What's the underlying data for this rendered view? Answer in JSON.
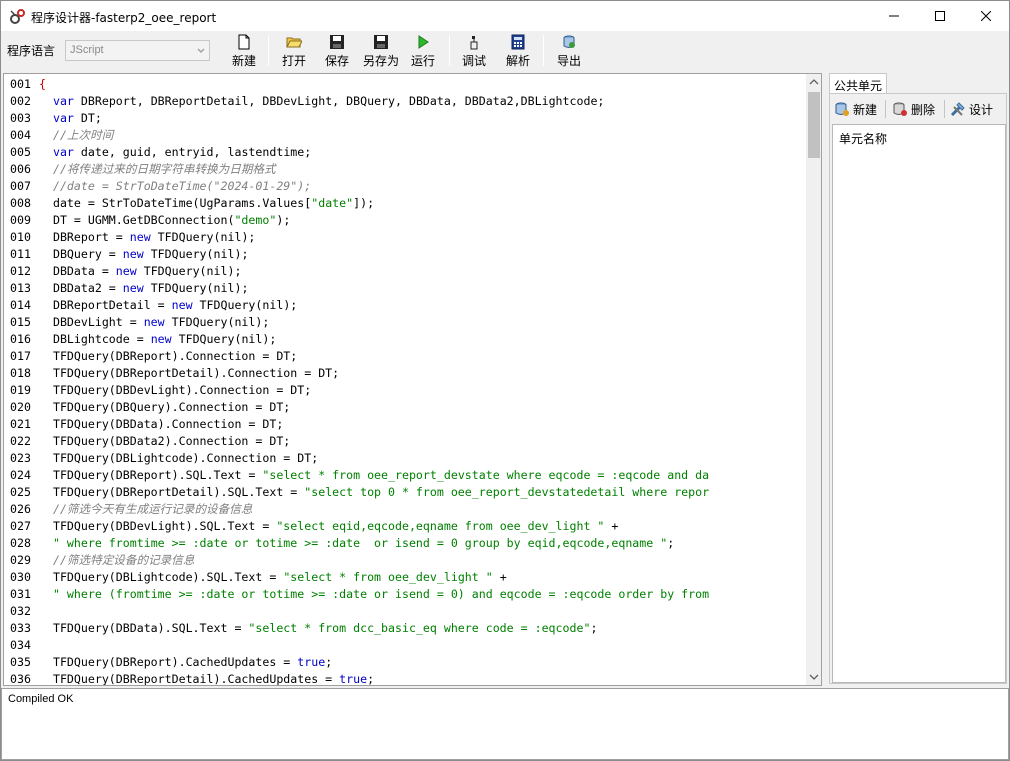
{
  "window": {
    "title": "程序设计器-fasterp2_oee_report"
  },
  "toolbar": {
    "lang_label": "程序语言",
    "lang_value": "JScript",
    "buttons": [
      {
        "label": "新建",
        "icon": "new-file-icon"
      },
      {
        "label": "打开",
        "icon": "open-folder-icon"
      },
      {
        "label": "保存",
        "icon": "save-icon"
      },
      {
        "label": "另存为",
        "icon": "save-as-icon"
      },
      {
        "label": "运行",
        "icon": "run-icon"
      },
      {
        "label": "调试",
        "icon": "debug-icon"
      },
      {
        "label": "解析",
        "icon": "parse-icon"
      },
      {
        "label": "导出",
        "icon": "export-icon"
      }
    ]
  },
  "editor": {
    "lines": [
      {
        "n": "001",
        "t": [
          [
            "sym",
            "{"
          ]
        ]
      },
      {
        "n": "002",
        "t": [
          [
            "id",
            "  "
          ],
          [
            "kw",
            "var"
          ],
          [
            "id",
            " DBReport, DBReportDetail, DBDevLight, DBQuery, DBData, DBData2,DBLightcode;"
          ]
        ]
      },
      {
        "n": "003",
        "t": [
          [
            "id",
            "  "
          ],
          [
            "kw",
            "var"
          ],
          [
            "id",
            " DT;"
          ]
        ]
      },
      {
        "n": "004",
        "t": [
          [
            "id",
            "  "
          ],
          [
            "cmt",
            "//上次时间"
          ]
        ]
      },
      {
        "n": "005",
        "t": [
          [
            "id",
            "  "
          ],
          [
            "kw",
            "var"
          ],
          [
            "id",
            " date, guid, entryid, lastendtime;"
          ]
        ]
      },
      {
        "n": "006",
        "t": [
          [
            "id",
            "  "
          ],
          [
            "cmt",
            "//将传递过来的日期字符串转换为日期格式"
          ]
        ]
      },
      {
        "n": "007",
        "t": [
          [
            "id",
            "  "
          ],
          [
            "cmt",
            "//date = StrToDateTime(\"2024-01-29\");"
          ]
        ]
      },
      {
        "n": "008",
        "t": [
          [
            "id",
            "  date = StrToDateTime(UgParams.Values["
          ],
          [
            "str",
            "\"date\""
          ],
          [
            "id",
            "]);"
          ]
        ]
      },
      {
        "n": "009",
        "t": [
          [
            "id",
            "  DT = UGMM.GetDBConnection("
          ],
          [
            "str",
            "\"demo\""
          ],
          [
            "id",
            ");"
          ]
        ]
      },
      {
        "n": "010",
        "t": [
          [
            "id",
            "  DBReport = "
          ],
          [
            "kw",
            "new"
          ],
          [
            "id",
            " TFDQuery(nil);"
          ]
        ]
      },
      {
        "n": "011",
        "t": [
          [
            "id",
            "  DBQuery = "
          ],
          [
            "kw",
            "new"
          ],
          [
            "id",
            " TFDQuery(nil);"
          ]
        ]
      },
      {
        "n": "012",
        "t": [
          [
            "id",
            "  DBData = "
          ],
          [
            "kw",
            "new"
          ],
          [
            "id",
            " TFDQuery(nil);"
          ]
        ]
      },
      {
        "n": "013",
        "t": [
          [
            "id",
            "  DBData2 = "
          ],
          [
            "kw",
            "new"
          ],
          [
            "id",
            " TFDQuery(nil);"
          ]
        ]
      },
      {
        "n": "014",
        "t": [
          [
            "id",
            "  DBReportDetail = "
          ],
          [
            "kw",
            "new"
          ],
          [
            "id",
            " TFDQuery(nil);"
          ]
        ]
      },
      {
        "n": "015",
        "t": [
          [
            "id",
            "  DBDevLight = "
          ],
          [
            "kw",
            "new"
          ],
          [
            "id",
            " TFDQuery(nil);"
          ]
        ]
      },
      {
        "n": "016",
        "t": [
          [
            "id",
            "  DBLightcode = "
          ],
          [
            "kw",
            "new"
          ],
          [
            "id",
            " TFDQuery(nil);"
          ]
        ]
      },
      {
        "n": "017",
        "t": [
          [
            "id",
            "  TFDQuery(DBReport).Connection = DT;"
          ]
        ]
      },
      {
        "n": "018",
        "t": [
          [
            "id",
            "  TFDQuery(DBReportDetail).Connection = DT;"
          ]
        ]
      },
      {
        "n": "019",
        "t": [
          [
            "id",
            "  TFDQuery(DBDevLight).Connection = DT;"
          ]
        ]
      },
      {
        "n": "020",
        "t": [
          [
            "id",
            "  TFDQuery(DBQuery).Connection = DT;"
          ]
        ]
      },
      {
        "n": "021",
        "t": [
          [
            "id",
            "  TFDQuery(DBData).Connection = DT;"
          ]
        ]
      },
      {
        "n": "022",
        "t": [
          [
            "id",
            "  TFDQuery(DBData2).Connection = DT;"
          ]
        ]
      },
      {
        "n": "023",
        "t": [
          [
            "id",
            "  TFDQuery(DBLightcode).Connection = DT;"
          ]
        ]
      },
      {
        "n": "024",
        "t": [
          [
            "id",
            "  TFDQuery(DBReport).SQL.Text = "
          ],
          [
            "str",
            "\"select * from oee_report_devstate where eqcode = :eqcode and da"
          ]
        ]
      },
      {
        "n": "025",
        "t": [
          [
            "id",
            "  TFDQuery(DBReportDetail).SQL.Text = "
          ],
          [
            "str",
            "\"select top 0 * from oee_report_devstatedetail where repor"
          ]
        ]
      },
      {
        "n": "026",
        "t": [
          [
            "id",
            "  "
          ],
          [
            "cmt",
            "//筛选今天有生成运行记录的设备信息"
          ]
        ]
      },
      {
        "n": "027",
        "t": [
          [
            "id",
            "  TFDQuery(DBDevLight).SQL.Text = "
          ],
          [
            "str",
            "\"select eqid,eqcode,eqname from oee_dev_light \""
          ],
          [
            "id",
            " +"
          ]
        ]
      },
      {
        "n": "028",
        "t": [
          [
            "id",
            "  "
          ],
          [
            "str",
            "\" where fromtime >= :date or totime >= :date  or isend = 0 group by eqid,eqcode,eqname \""
          ],
          [
            "id",
            ";"
          ]
        ]
      },
      {
        "n": "029",
        "t": [
          [
            "id",
            "  "
          ],
          [
            "cmt",
            "//筛选特定设备的记录信息"
          ]
        ]
      },
      {
        "n": "030",
        "t": [
          [
            "id",
            "  TFDQuery(DBLightcode).SQL.Text = "
          ],
          [
            "str",
            "\"select * from oee_dev_light \""
          ],
          [
            "id",
            " +"
          ]
        ]
      },
      {
        "n": "031",
        "t": [
          [
            "id",
            "  "
          ],
          [
            "str",
            "\" where (fromtime >= :date or totime >= :date or isend = 0) and eqcode = :eqcode order by from"
          ]
        ]
      },
      {
        "n": "032",
        "t": []
      },
      {
        "n": "033",
        "t": [
          [
            "id",
            "  TFDQuery(DBData).SQL.Text = "
          ],
          [
            "str",
            "\"select * from dcc_basic_eq where code = :eqcode\""
          ],
          [
            "id",
            ";"
          ]
        ]
      },
      {
        "n": "034",
        "t": []
      },
      {
        "n": "035",
        "t": [
          [
            "id",
            "  TFDQuery(DBReport).CachedUpdates = "
          ],
          [
            "kw",
            "true"
          ],
          [
            "id",
            ";"
          ]
        ]
      },
      {
        "n": "036",
        "t": [
          [
            "id",
            "  TFDQuery(DBReportDetail).CachedUpdates = "
          ],
          [
            "kw",
            "true"
          ],
          [
            "id",
            ";"
          ]
        ]
      }
    ]
  },
  "panel": {
    "tab": "公共单元",
    "buttons": [
      {
        "label": "新建",
        "icon": "new-unit-icon"
      },
      {
        "label": "删除",
        "icon": "delete-unit-icon"
      },
      {
        "label": "设计",
        "icon": "design-tools-icon"
      }
    ],
    "list_header": "单元名称"
  },
  "status": {
    "text": "Compiled OK"
  }
}
